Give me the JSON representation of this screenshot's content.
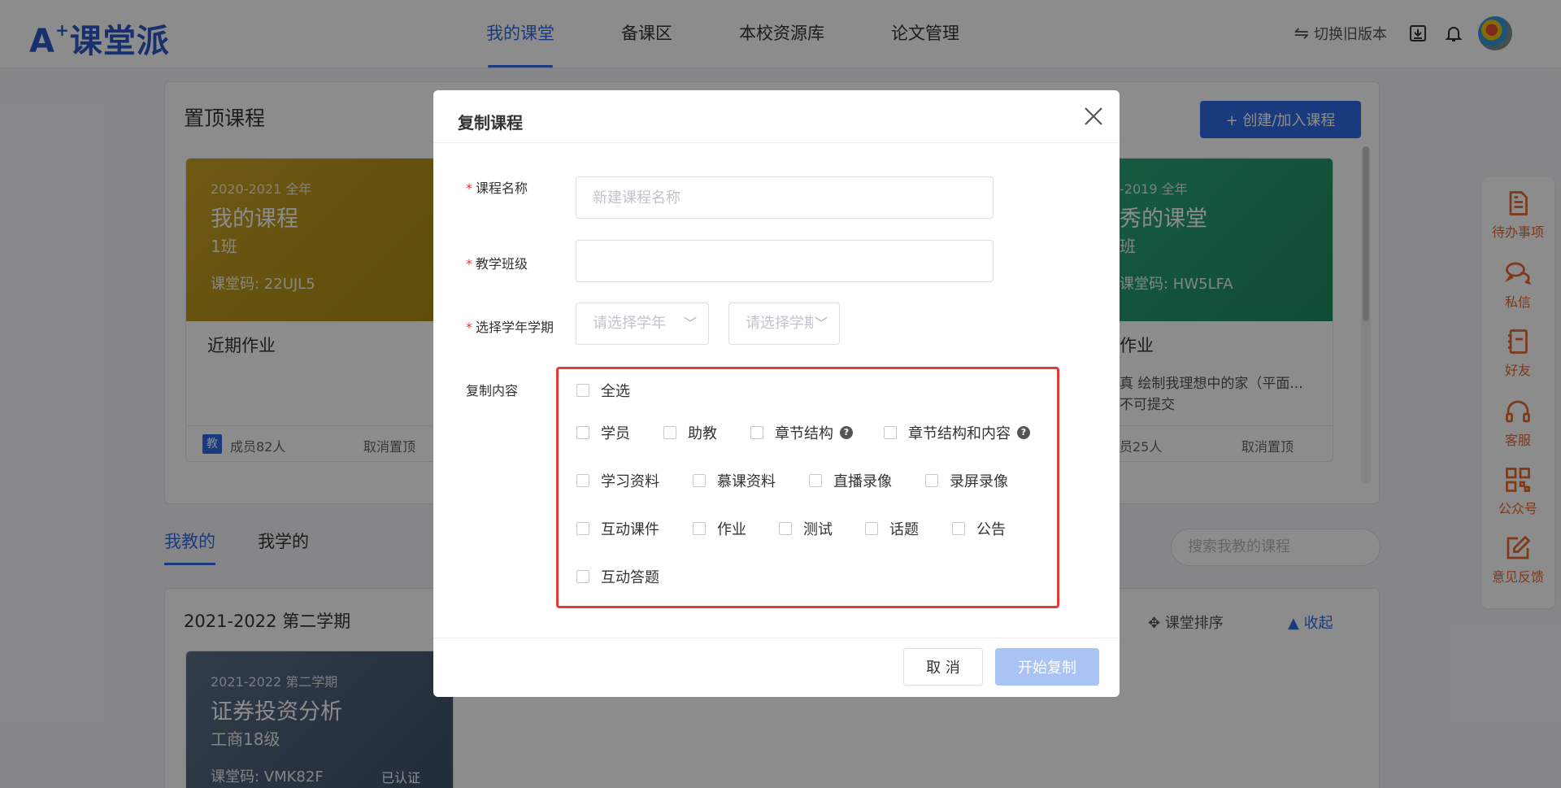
{
  "header": {
    "logo": "A",
    "logo_sup": "+",
    "logo_text": "课堂派",
    "nav": [
      {
        "label": "我的课堂",
        "active": true
      },
      {
        "label": "备课区",
        "active": false
      },
      {
        "label": "本校资源库",
        "active": false
      },
      {
        "label": "论文管理",
        "active": false
      }
    ],
    "switch_old": "切换旧版本"
  },
  "background": {
    "pinned_title": "置顶课程",
    "create_button": "+ 创建/加入课程",
    "cards": [
      {
        "year": "2020-2021 全年",
        "name": "我的课程",
        "class": "1班",
        "code": "课堂码: 22UJL5",
        "body_title": "近期作业",
        "members": "成员82人",
        "unpin": "取消置顶",
        "teacher_badge": "教"
      },
      {
        "year": "-2019 全年",
        "name": "秀的课堂",
        "class": "班",
        "code": "课堂码: HW5LFA",
        "body_title": "作业",
        "assignment": "真 绘制我理想中的家（平面...",
        "status": "不可提交",
        "members": "员25人",
        "unpin": "取消置顶"
      }
    ],
    "tabs": [
      "我教的",
      "我学的"
    ],
    "search_placeholder": "搜索我教的课程",
    "term_title": "2021-2022 第二学期",
    "sort": "课堂排序",
    "collapse": "收起",
    "card3": {
      "year": "2021-2022 第二学期",
      "name": "证券投资分析",
      "class": "工商18级",
      "code": "课堂码: VMK82F",
      "verified": "已认证"
    }
  },
  "sidebar": [
    {
      "label": "待办事项",
      "icon": "todo-icon"
    },
    {
      "label": "私信",
      "icon": "chat-icon"
    },
    {
      "label": "好友",
      "icon": "contacts-icon"
    },
    {
      "label": "客服",
      "icon": "headset-icon"
    },
    {
      "label": "公众号",
      "icon": "qrcode-icon"
    },
    {
      "label": "意见反馈",
      "icon": "feedback-icon"
    }
  ],
  "modal": {
    "title": "复制课程",
    "course_name_label": "课程名称",
    "course_name_placeholder": "新建课程名称",
    "class_label": "教学班级",
    "class_value": "",
    "term_label": "选择学年学期",
    "year_placeholder": "请选择学年",
    "semester_placeholder": "请选择学期",
    "content_label": "复制内容",
    "select_all": "全选",
    "options_row1": [
      "学员",
      "助教",
      "章节结构",
      "章节结构和内容"
    ],
    "options_row2": [
      "学习资料",
      "慕课资料",
      "直播录像",
      "录屏录像"
    ],
    "options_row3": [
      "互动课件",
      "作业",
      "测试",
      "话题",
      "公告"
    ],
    "options_row4": [
      "互动答题"
    ],
    "cancel_label": "取 消",
    "start_label": "开始复制"
  }
}
